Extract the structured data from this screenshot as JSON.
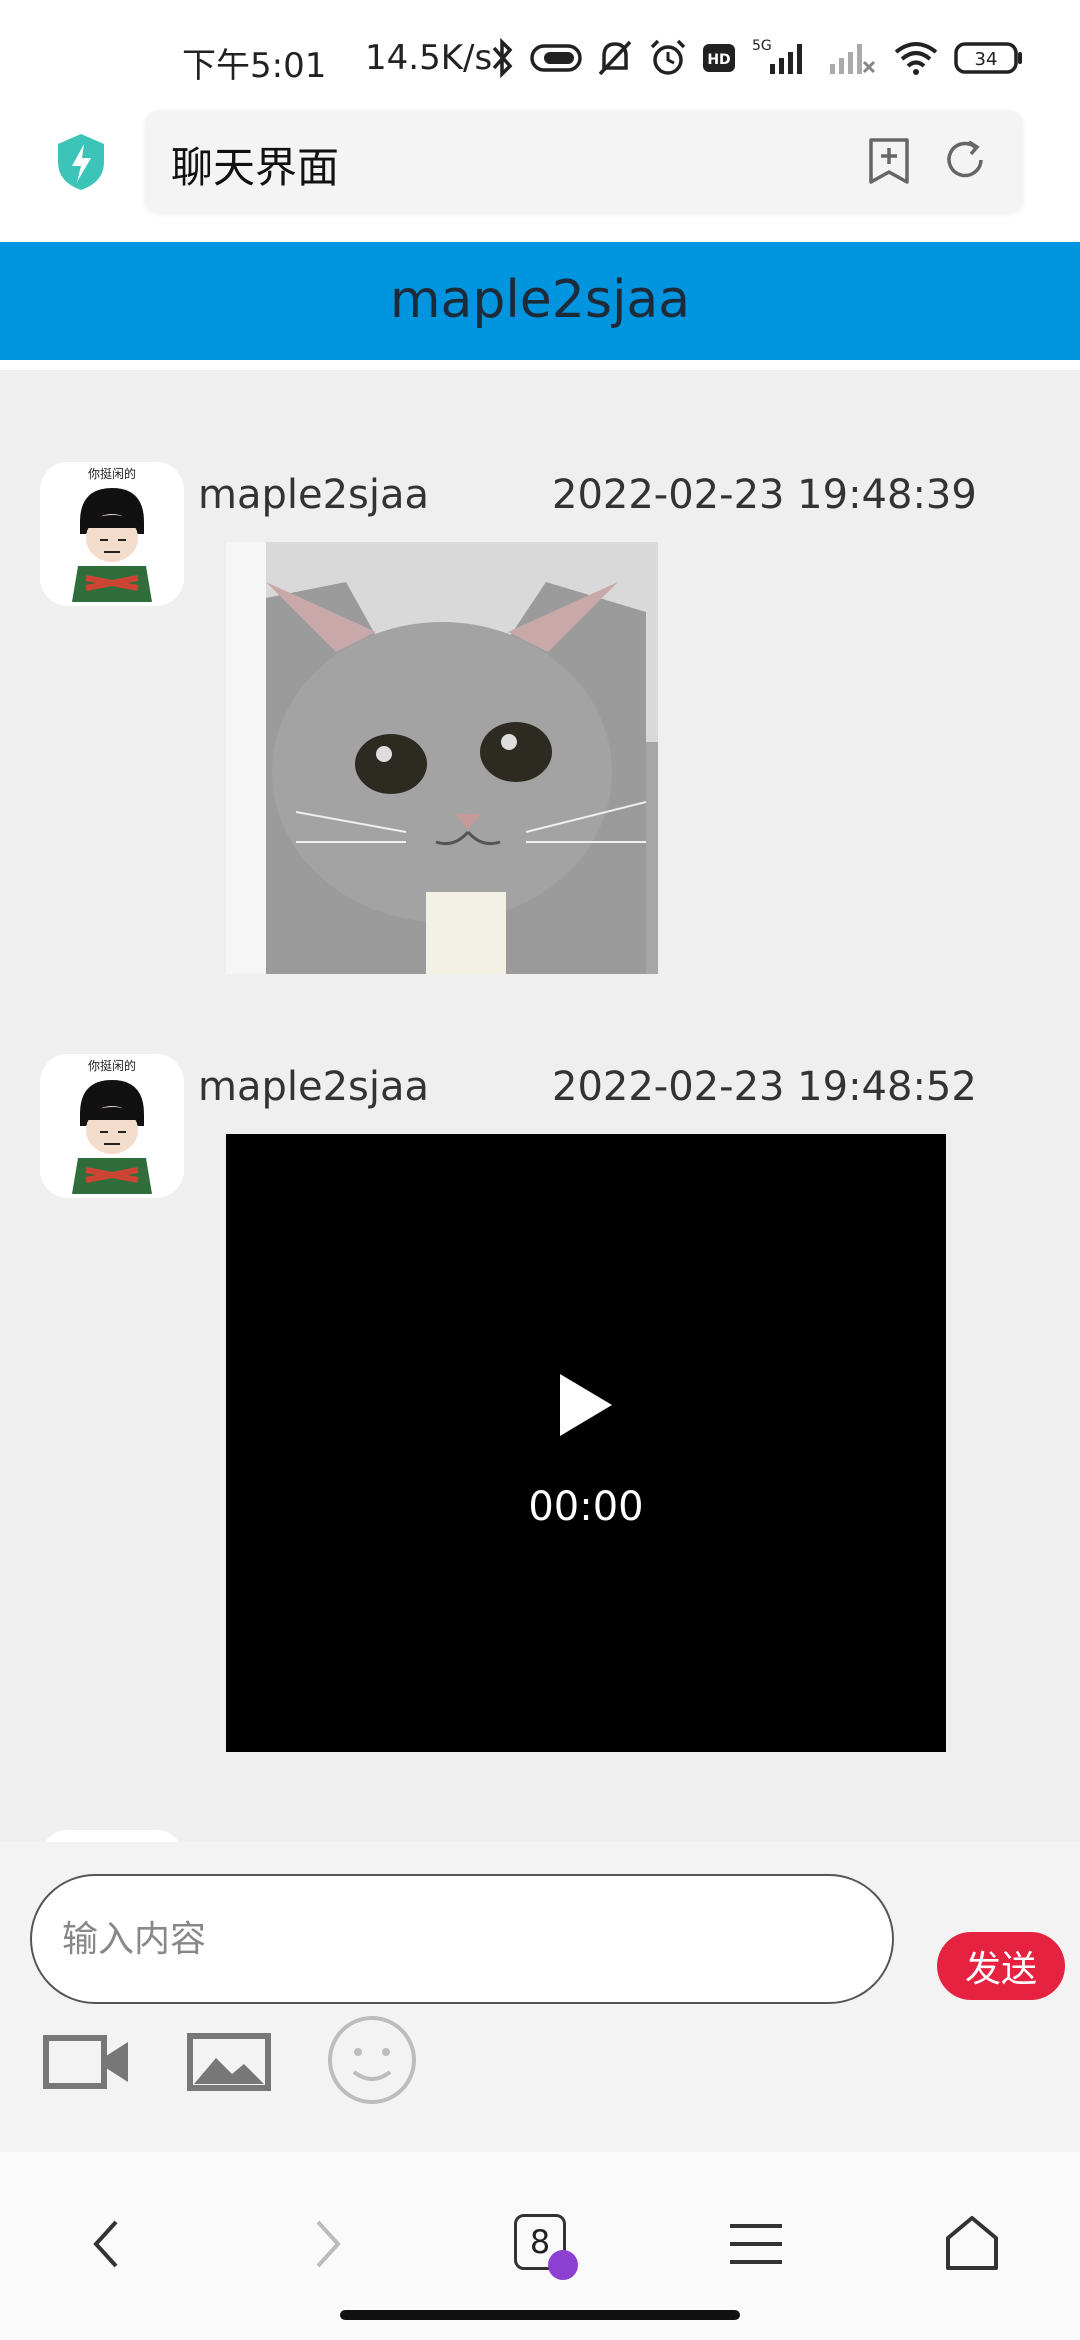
{
  "status_bar": {
    "time": "下午5:01",
    "net_speed": "14.5K/s",
    "network_label": "5G",
    "hd_label": "HD",
    "battery": "34",
    "icons": [
      "bluetooth-icon",
      "toggle-icon",
      "mute-icon",
      "alarm-icon",
      "hd-icon",
      "signal-icon",
      "signal-off-icon",
      "wifi-icon",
      "battery-icon"
    ]
  },
  "browser": {
    "page_title": "聊天界面",
    "icons": [
      "shield-icon",
      "add-bookmark-icon",
      "refresh-icon"
    ],
    "shield_color": "#3cc4b8"
  },
  "chat": {
    "header_title": "maple2sjaa",
    "header_color": "#0095de",
    "messages": [
      {
        "sender": "maple2sjaa",
        "time": "2022-02-23 19:48:39",
        "type": "image"
      },
      {
        "sender": "maple2sjaa",
        "time": "2022-02-23 19:48:52",
        "type": "video",
        "video_time": "00:00"
      }
    ],
    "avatar_caption": "你挺闲的"
  },
  "composer": {
    "placeholder": "输入内容",
    "send_label": "发送",
    "send_color": "#e52341",
    "tools": [
      "video-camera-icon",
      "image-icon",
      "emoji-icon"
    ]
  },
  "bottom_nav": {
    "tab_count": "8",
    "items": [
      "back-icon",
      "forward-icon",
      "tabs-icon",
      "menu-icon",
      "home-icon"
    ]
  }
}
